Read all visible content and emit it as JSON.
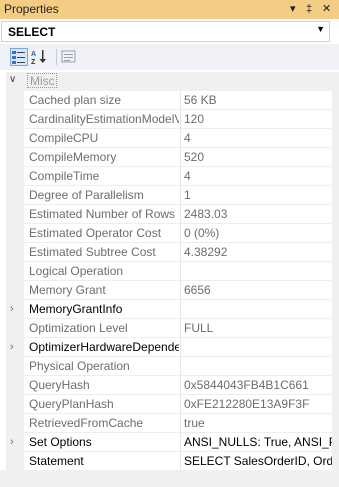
{
  "window": {
    "title": "Properties",
    "controls": [
      "▾",
      "‡",
      "✕"
    ]
  },
  "object_selector": {
    "value": "SELECT"
  },
  "toolbar": {
    "buttons": [
      {
        "icon": "categorized-icon",
        "active": true
      },
      {
        "icon": "alphabetical-sort-icon",
        "active": false
      },
      {
        "icon": "property-pages-icon",
        "active": false
      }
    ]
  },
  "grid": {
    "category": "Misc",
    "rows": [
      {
        "name": "Cached plan size",
        "value": "56 KB",
        "expandable": false,
        "dark": false
      },
      {
        "name": "CardinalityEstimationModelVersion",
        "value": "120",
        "expandable": false,
        "dark": false
      },
      {
        "name": "CompileCPU",
        "value": "4",
        "expandable": false,
        "dark": false
      },
      {
        "name": "CompileMemory",
        "value": "520",
        "expandable": false,
        "dark": false
      },
      {
        "name": "CompileTime",
        "value": "4",
        "expandable": false,
        "dark": false
      },
      {
        "name": "Degree of Parallelism",
        "value": "1",
        "expandable": false,
        "dark": false
      },
      {
        "name": "Estimated Number of Rows",
        "value": "2483.03",
        "expandable": false,
        "dark": false
      },
      {
        "name": "Estimated Operator Cost",
        "value": "0 (0%)",
        "expandable": false,
        "dark": false
      },
      {
        "name": "Estimated Subtree Cost",
        "value": "4.38292",
        "expandable": false,
        "dark": false
      },
      {
        "name": "Logical Operation",
        "value": "",
        "expandable": false,
        "dark": false
      },
      {
        "name": "Memory Grant",
        "value": "6656",
        "expandable": false,
        "dark": false
      },
      {
        "name": "MemoryGrantInfo",
        "value": "",
        "expandable": true,
        "dark": true
      },
      {
        "name": "Optimization Level",
        "value": "FULL",
        "expandable": false,
        "dark": false
      },
      {
        "name": "OptimizerHardwareDependentProperties",
        "value": "",
        "expandable": true,
        "dark": true
      },
      {
        "name": "Physical Operation",
        "value": "",
        "expandable": false,
        "dark": false
      },
      {
        "name": "QueryHash",
        "value": "0x5844043FB4B1C661",
        "expandable": false,
        "dark": false
      },
      {
        "name": "QueryPlanHash",
        "value": "0xFE212280E13A9F3F",
        "expandable": false,
        "dark": false
      },
      {
        "name": "RetrievedFromCache",
        "value": "true",
        "expandable": false,
        "dark": false
      },
      {
        "name": "Set Options",
        "value": "ANSI_NULLS: True, ANSI_PADDING: True",
        "expandable": true,
        "dark": true
      },
      {
        "name": "Statement",
        "value": "SELECT  SalesOrderID, OrderDate",
        "expandable": false,
        "dark": true
      }
    ]
  }
}
